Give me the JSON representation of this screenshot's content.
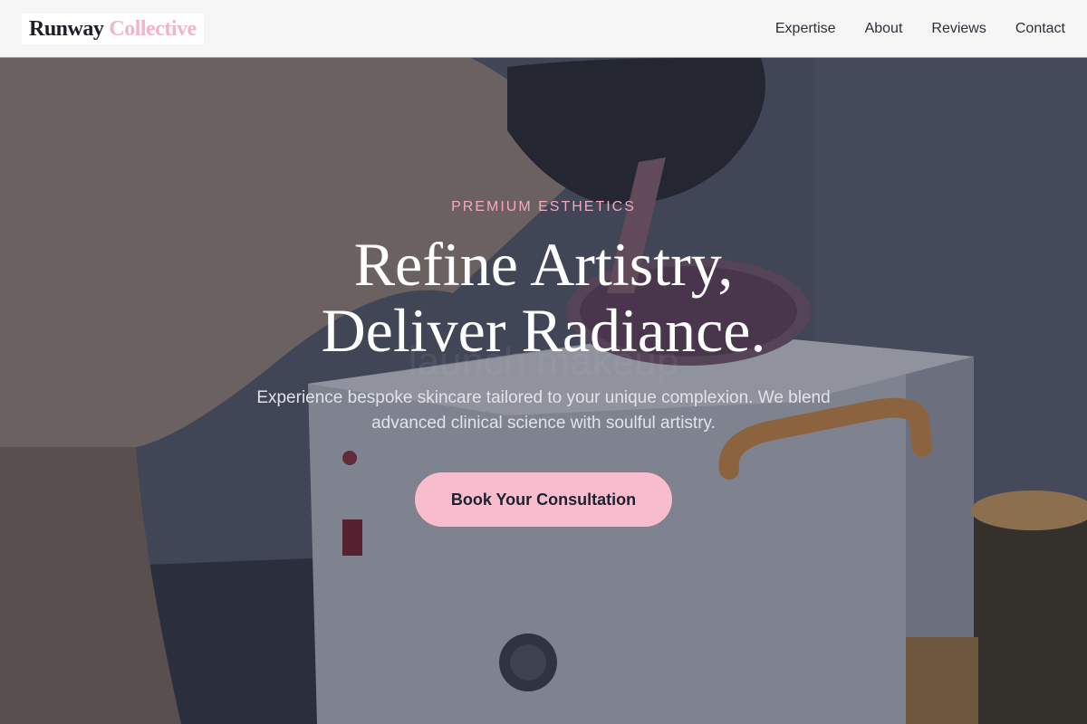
{
  "header": {
    "brand_primary": "Runway",
    "brand_accent": "Collective",
    "nav": [
      {
        "label": "Expertise"
      },
      {
        "label": "About"
      },
      {
        "label": "Reviews"
      },
      {
        "label": "Contact"
      }
    ]
  },
  "hero": {
    "eyebrow": "PREMIUM ESTHETICS",
    "headline_line1": "Refine Artistry,",
    "headline_line2": "Deliver Radiance.",
    "subtitle": "Experience bespoke skincare tailored to your unique complexion. We blend advanced clinical science with soulful artistry.",
    "cta_label": "Book Your Consultation",
    "background_image": "wax-warmer-photo"
  },
  "colors": {
    "brand_dark": "#1c1f2b",
    "brand_pink": "#f3b4c6",
    "cta_background": "#f8bccc",
    "eyebrow": "#f2a9bf"
  }
}
